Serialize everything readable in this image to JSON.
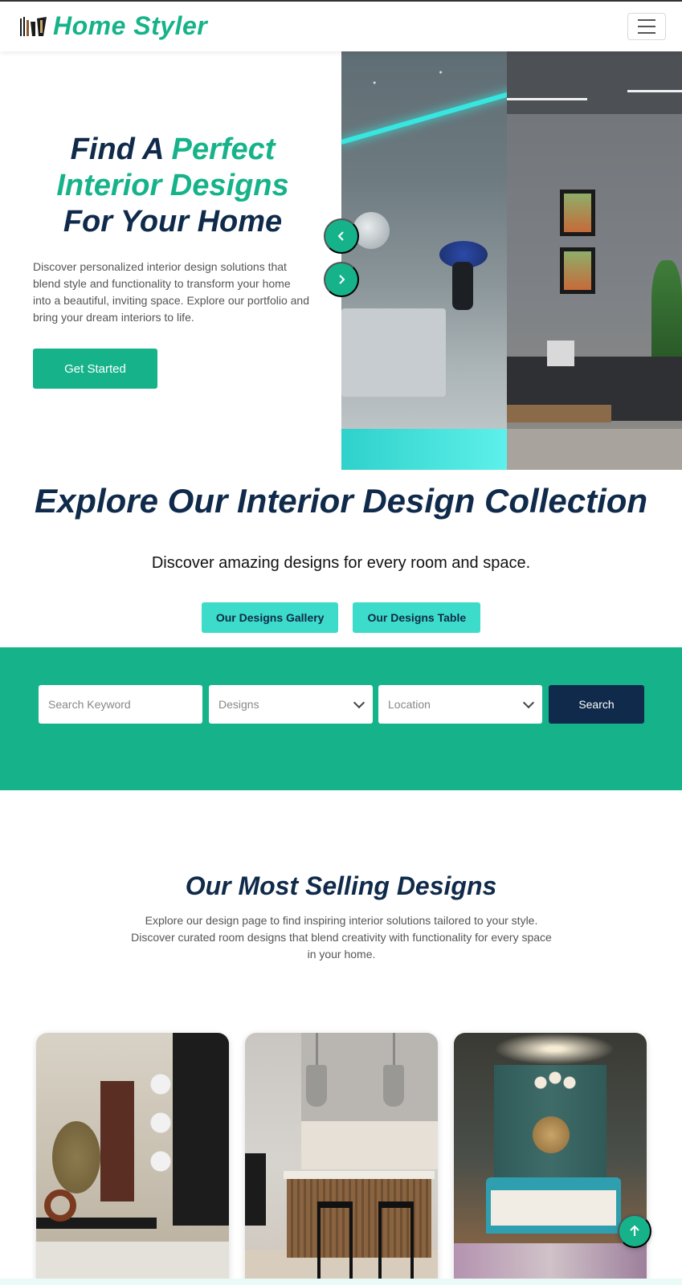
{
  "navbar": {
    "brand_name": "Home Styler",
    "logo_icon": "brand-logo-icon",
    "menu_icon": "hamburger-menu-icon"
  },
  "hero": {
    "title_line1_a": "Find A ",
    "title_line1_b": "Perfect",
    "title_line2": "Interior Designs",
    "title_line3": "For Your Home",
    "description": "Discover personalized interior design solutions that blend style and functionality to transform your home into a beautiful, inviting space. Explore our portfolio and bring your dream interiors to life.",
    "cta_label": "Get Started",
    "prev_icon": "chevron-left-icon",
    "next_icon": "chevron-right-icon"
  },
  "collection": {
    "title": "Explore Our Interior Design Collection",
    "subtitle": "Discover amazing designs for every room and space.",
    "gallery_button": "Our Designs Gallery",
    "table_button": "Our Designs Table"
  },
  "search": {
    "keyword_placeholder": "Search Keyword",
    "designs_value": "Designs",
    "location_value": "Location",
    "search_button": "Search"
  },
  "selling": {
    "title": "Our Most Selling Designs",
    "description": "Explore our design page to find inspiring interior solutions tailored to your style. Discover curated room designs that blend creativity with functionality for every space in your home."
  },
  "colors": {
    "brand": "#16b38a",
    "navy": "#0f2a4a",
    "teal_button": "#3ddbc9"
  },
  "scroll_top_icon": "arrow-up-icon"
}
